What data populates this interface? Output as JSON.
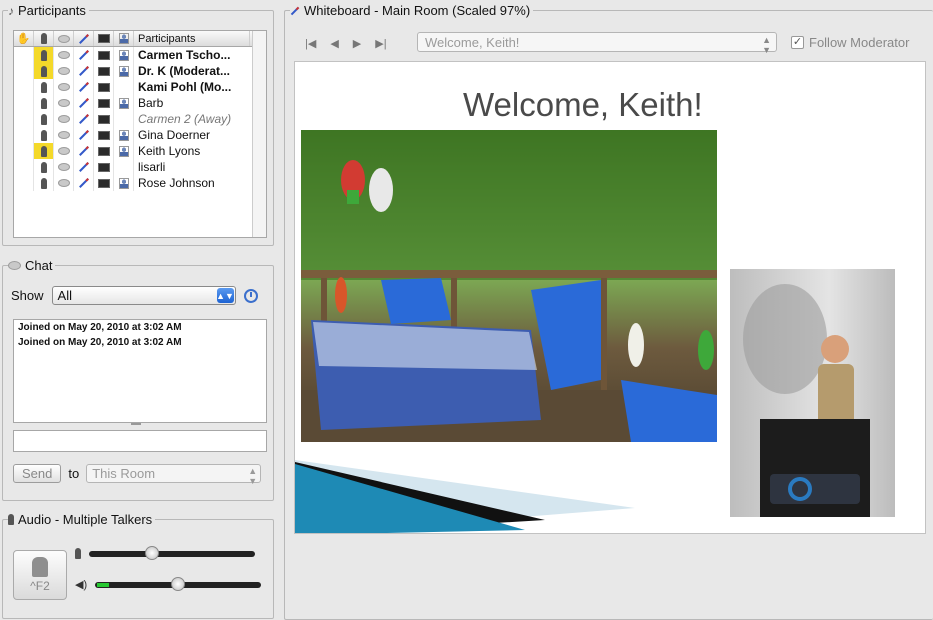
{
  "participants": {
    "title": "Participants",
    "column_header": "Participants",
    "rows": [
      {
        "name": "Carmen Tscho...",
        "bold": true,
        "away": false,
        "mic_highlight": true,
        "person": true
      },
      {
        "name": "Dr. K (Moderat...",
        "bold": true,
        "away": false,
        "mic_highlight": true,
        "person": true
      },
      {
        "name": "Kami Pohl (Mo...",
        "bold": true,
        "away": false,
        "mic_highlight": false,
        "person": false
      },
      {
        "name": "Barb",
        "bold": false,
        "away": false,
        "mic_highlight": false,
        "person": true
      },
      {
        "name": "Carmen 2 (Away)",
        "bold": false,
        "away": true,
        "mic_highlight": false,
        "person": false
      },
      {
        "name": "Gina Doerner",
        "bold": false,
        "away": false,
        "mic_highlight": false,
        "person": true
      },
      {
        "name": "Keith Lyons",
        "bold": false,
        "away": false,
        "mic_highlight": true,
        "person": true
      },
      {
        "name": "lisarli",
        "bold": false,
        "away": false,
        "mic_highlight": false,
        "person": false
      },
      {
        "name": "Rose Johnson",
        "bold": false,
        "away": false,
        "mic_highlight": false,
        "person": true
      }
    ]
  },
  "chat": {
    "title": "Chat",
    "show_label": "Show",
    "show_value": "All",
    "messages": [
      "Joined on May 20, 2010 at 3:02 AM",
      "Joined on May 20, 2010 at 3:02 AM"
    ],
    "send_label": "Send",
    "to_label": "to",
    "to_value": "This Room"
  },
  "audio": {
    "title": "Audio - Multiple Talkers",
    "talk_key": "^F2",
    "mic_level": 0.37,
    "speaker_volume": 0.5
  },
  "whiteboard": {
    "title": "Whiteboard - Main Room (Scaled 97%)",
    "slide_select": "Welcome, Keith!",
    "follow_moderator": "Follow Moderator",
    "follow_checked": true,
    "slide_title": "Welcome, Keith!"
  }
}
